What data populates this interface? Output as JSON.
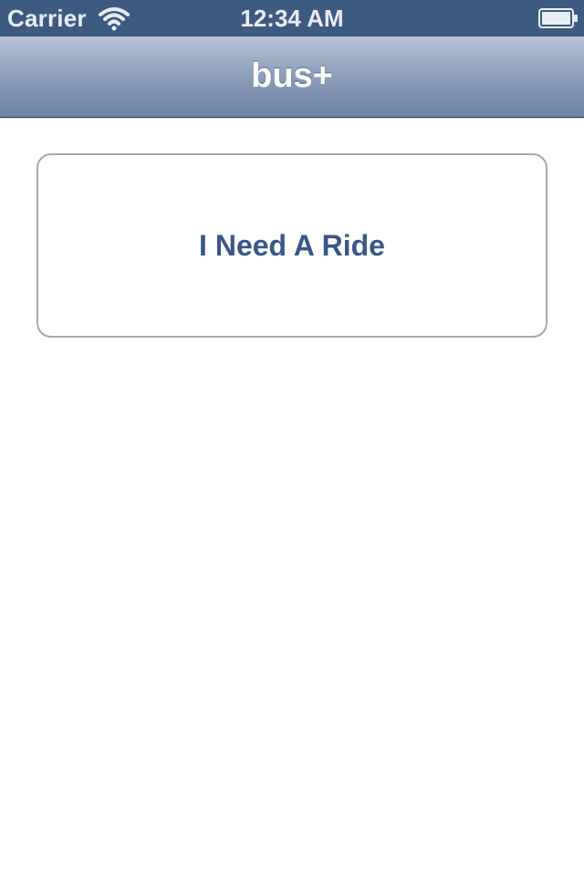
{
  "status_bar": {
    "carrier": "Carrier",
    "time": "12:34 AM",
    "wifi_icon": "wifi-icon",
    "battery_icon": "battery-icon",
    "background_color": "#3f5a81"
  },
  "nav_bar": {
    "title": "bus+"
  },
  "main": {
    "ride_button_label": "I Need A Ride",
    "ride_button_text_color": "#3a5688"
  }
}
